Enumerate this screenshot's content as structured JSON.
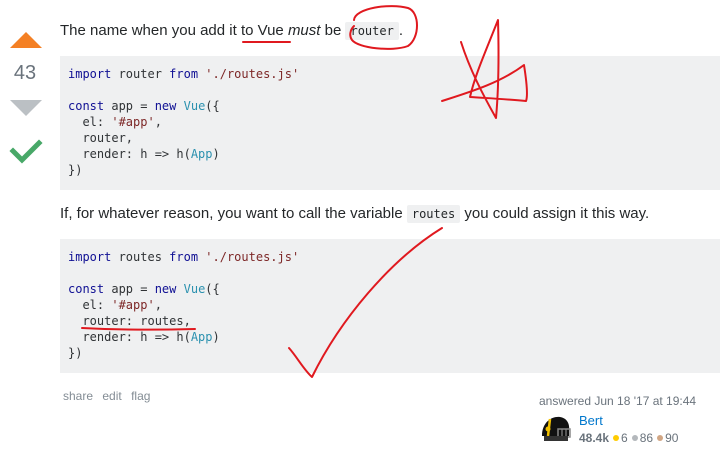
{
  "vote": {
    "count": "43",
    "up_color": "#f48024",
    "down_color": "#bbc0c4",
    "accepted_color": "#48a868"
  },
  "post": {
    "p1_before": "The name when you add it to Vue ",
    "p1_emph": "must",
    "p1_mid": " be ",
    "p1_code": "router",
    "p1_after": ".",
    "code1": {
      "line1_kw": "import",
      "line1_name": " router ",
      "line1_from": "from",
      "line1_str": " './routes.js'",
      "line3_kw": "const",
      "line3_mid": " app = ",
      "line3_new": "new",
      "line3_type": " Vue",
      "line3_end": "({",
      "line4_a": "  el: ",
      "line4_str": "'#app'",
      "line4_end": ",",
      "line5": "  router,",
      "line6_a": "  render: h => h(",
      "line6_type": "App",
      "line6_end": ")",
      "line7": "})"
    },
    "p2_before": "If, for whatever reason, you want to call the variable ",
    "p2_code": "routes",
    "p2_after": " you could assign it this way.",
    "code2": {
      "line1_kw": "import",
      "line1_name": " routes ",
      "line1_from": "from",
      "line1_str": " './routes.js'",
      "line3_kw": "const",
      "line3_mid": " app = ",
      "line3_new": "new",
      "line3_type": " Vue",
      "line3_end": "({",
      "line4_a": "  el: ",
      "line4_str": "'#app'",
      "line4_end": ",",
      "line5": "  router: routes,",
      "line6_a": "  render: h => h(",
      "line6_type": "App",
      "line6_end": ")",
      "line7": "})"
    }
  },
  "menu": {
    "share": "share",
    "edit": "edit",
    "flag": "flag"
  },
  "user": {
    "answered": "answered Jun 18 '17 at 19:44",
    "name": "Bert",
    "rep": "48.4k",
    "gold": "6",
    "silver": "86",
    "bronze": "90"
  },
  "annotation_color": "#e0191f"
}
